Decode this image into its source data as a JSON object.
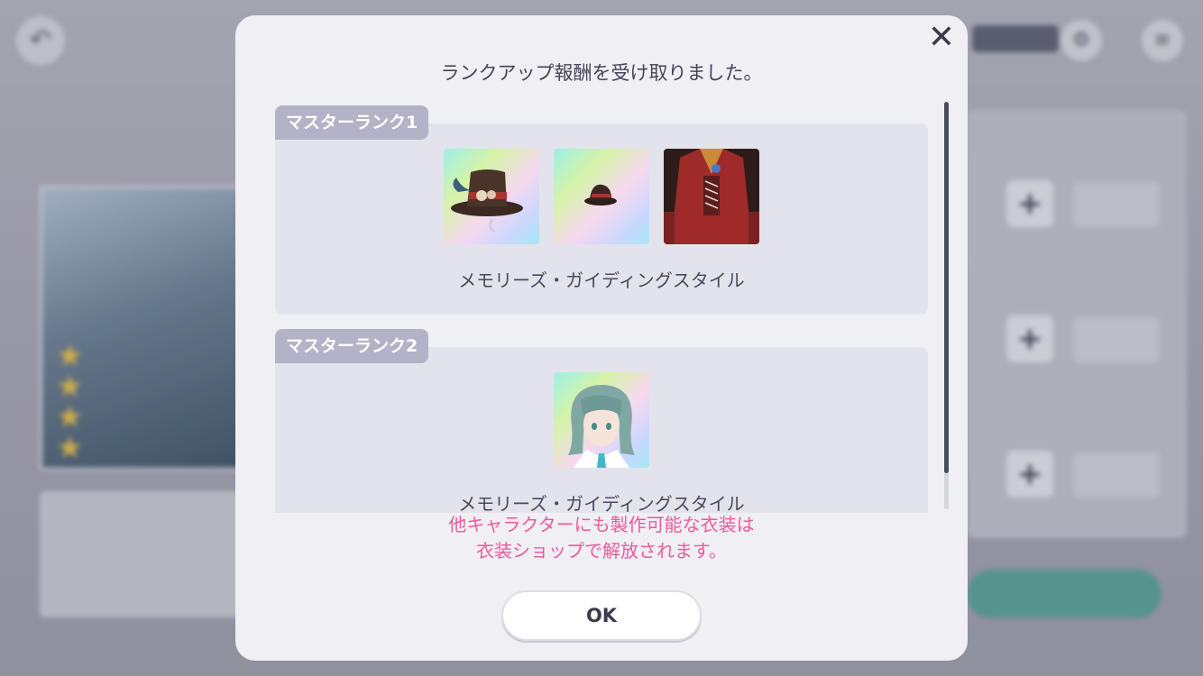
{
  "modal": {
    "title": "ランクアップ報酬を受け取りました。",
    "ok_label": "OK",
    "note_lines": [
      "他キャラクターにも製作可能な衣装は",
      "衣装ショップで解放されます。"
    ]
  },
  "rewards": [
    {
      "rank_label": "マスターランク1",
      "items": [
        {
          "icon": "top-hat-costume-icon"
        },
        {
          "icon": "small-hat-accessory-icon"
        },
        {
          "icon": "red-coat-outfit-icon"
        }
      ],
      "caption": "メモリーズ・ガイディングスタイル"
    },
    {
      "rank_label": "マスターランク2",
      "items": [
        {
          "icon": "character-hairstyle-icon"
        }
      ],
      "caption": "メモリーズ・ガイディングスタイル"
    }
  ],
  "colors": {
    "note": "#ec5a9b",
    "badge": "#b3b2c7",
    "card": "#e3e3ec",
    "modal": "#efeff4"
  }
}
